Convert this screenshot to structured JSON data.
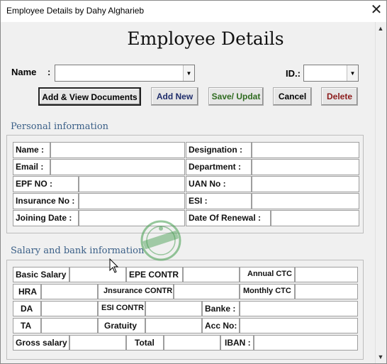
{
  "window": {
    "title": "Employee Details by Dahy Algharieb",
    "close_glyph": "✕"
  },
  "heading": "Employee Details",
  "top": {
    "name_label": "Name",
    "name_colon": ":",
    "name_value": "",
    "id_label": "ID.:",
    "id_value": "",
    "dropdown_glyph": "▼"
  },
  "buttons": {
    "add_view": "Add & View Documents",
    "add_new": "Add New",
    "save": "Save/ Updat",
    "cancel": "Cancel",
    "delete": "Delete"
  },
  "colors": {
    "accent": "#3a5f87",
    "add_new_text": "#1f2d6b",
    "save_text": "#2e6b1f",
    "delete_text": "#8b1a1a"
  },
  "personal": {
    "title": "Personal information",
    "name": "Name :",
    "email": "Email :",
    "epf": "EPF NO :",
    "insurance": "Insurance No :",
    "joining": "Joining Date  :",
    "designation": "Designation :",
    "department": "Department :",
    "uan": "UAN No :",
    "esi": " ESI :",
    "renewal": "Date Of Renewal :"
  },
  "salary": {
    "title": "Salary and bank information",
    "basic": "Basic Salary",
    "hra": "HRA",
    "da": "DA",
    "ta": "TA",
    "gross": "Gross salary",
    "epe": "EPE  CONTR",
    "jnsurance": "Jnsurance CONTR",
    "esi_contr": "ESI CONTR",
    "gratuity": "Gratuity",
    "total": "Total",
    "annual": "Annual CTC",
    "monthly": "Monthly CTC",
    "banke": "Banke :",
    "acc": "Acc No:",
    "iban": "IBAN :"
  },
  "scrollbar": {
    "up_glyph": "▲",
    "down_glyph": "▼"
  }
}
